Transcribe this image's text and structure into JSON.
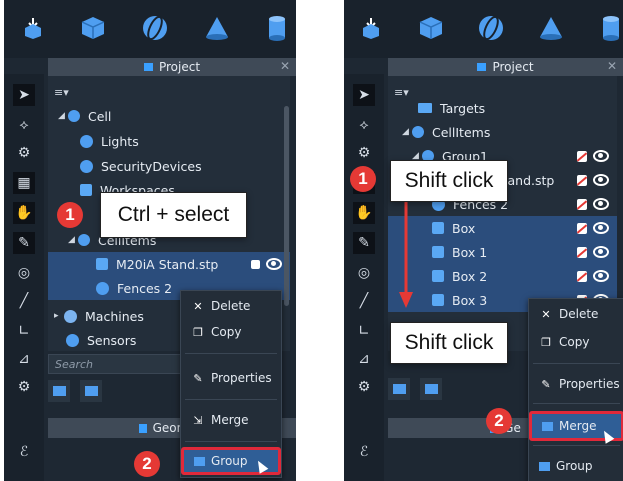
{
  "colors": {
    "accent": "#4f9ef0",
    "highlight_border": "#e0293a",
    "step_badge": "#e53935",
    "panel_bg": "#1e2833",
    "selection_bg": "#2b4d7c"
  },
  "left": {
    "toolbar_icons": [
      "import-icon",
      "box-icon",
      "sphere-icon",
      "cone-icon",
      "cylinder-icon"
    ],
    "project_title": "Project",
    "tree": [
      {
        "label": "Cell",
        "icon": "cell-icon"
      },
      {
        "label": "Lights",
        "icon": "lightbulb-icon"
      },
      {
        "label": "SecurityDevices",
        "icon": "shield-icon"
      },
      {
        "label": "Workspaces",
        "icon": "workspace-icon"
      },
      {
        "label": "CellItems",
        "icon": "cell-icon"
      },
      {
        "label": "M20iA Stand.stp",
        "icon": "part-icon"
      },
      {
        "label": "Fences 2",
        "icon": "fence-icon"
      },
      {
        "label": "Machines",
        "icon": "machine-icon"
      },
      {
        "label": "Sensors",
        "icon": "sensor-icon"
      }
    ],
    "search_placeholder": "Search",
    "geometry_title": "Geometr",
    "context_menu": [
      "Delete",
      "Copy",
      "Properties",
      "Merge",
      "Group"
    ],
    "callout": "Ctrl + select",
    "step1": "1",
    "step2": "2"
  },
  "right": {
    "project_title": "Project",
    "tree": [
      {
        "label": "Targets"
      },
      {
        "label": "CellItems"
      },
      {
        "label": "Group1"
      },
      {
        "label": "M20iA Stand.stp"
      },
      {
        "label": "Fences 2"
      },
      {
        "label": "Box"
      },
      {
        "label": "Box 1"
      },
      {
        "label": "Box 2"
      },
      {
        "label": "Box 3"
      }
    ],
    "geometry_title": "Ge",
    "context_menu": [
      "Delete",
      "Copy",
      "Properties",
      "Merge",
      "Group"
    ],
    "callout_top": "Shift click",
    "callout_bottom": "Shift click",
    "step1": "1",
    "step2": "2"
  }
}
